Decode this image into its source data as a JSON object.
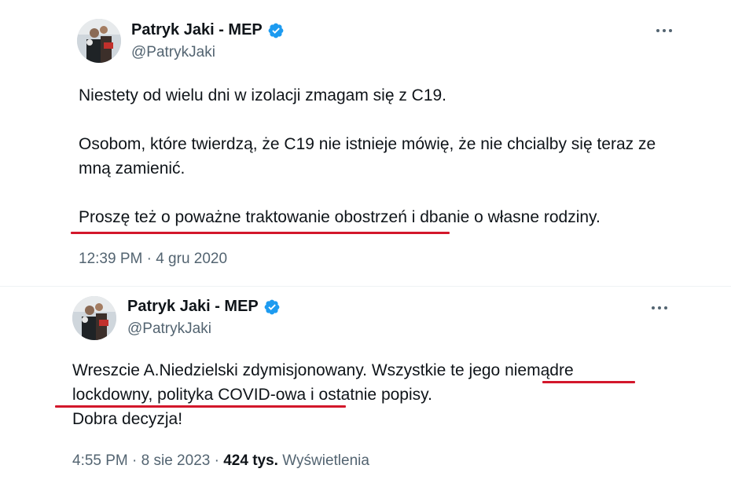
{
  "tweets": [
    {
      "author_name": "Patryk Jaki - MEP",
      "handle": "@PatrykJaki",
      "paragraphs": [
        "Niestety od wielu dni w izolacji zmagam się z C19.",
        "Osobom, które twierdzą, że C19 nie istnieje mówię, że nie chcialby się teraz ze mną zamienić.",
        "Proszę też o poważne traktowanie obostrzeń i dbanie o własne rodziny."
      ],
      "timestamp": "12:39 PM · 4 gru 2020"
    },
    {
      "author_name": "Patryk Jaki - MEP",
      "handle": "@PatrykJaki",
      "lines": [
        "Wreszcie A.Niedzielski zdymisjonowany. Wszystkie te jego niemądre",
        "lockdowny, polityka COVID-owa i ostatnie popisy.",
        "Dobra decyzja!"
      ],
      "timestamp": "4:55 PM · 8 sie 2023 · ",
      "views_count": "424 tys.",
      "views_label": "Wyświetlenia"
    }
  ],
  "colors": {
    "verified": "#1d9bf0",
    "underline": "#d3172b",
    "secondary_text": "#536471"
  }
}
